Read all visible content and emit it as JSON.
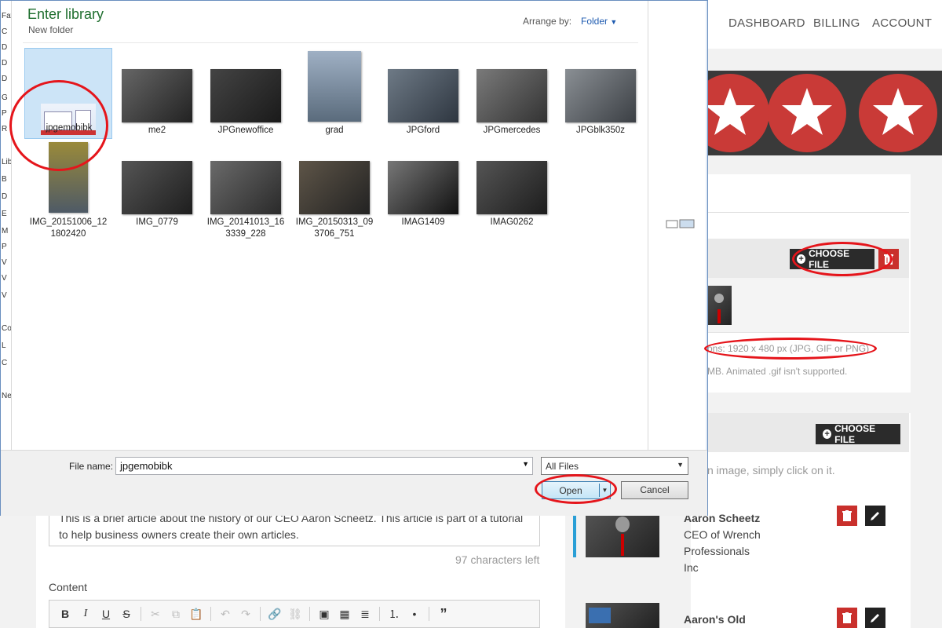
{
  "nav": {
    "dashboard": "DASHBOARD",
    "billing": "BILLING",
    "account": "ACCOUNT"
  },
  "upload": {
    "choose_file_label": "CHOOSE FILE",
    "dimensions_hint": "ons: 1920 x 480 px (JPG, GIF or PNG)",
    "size_hint": "MB. Animated .gif isn't supported.",
    "choose_file_label_2": "CHOOSE FILE",
    "click_hint": "n image, simply click on it."
  },
  "authors": [
    {
      "name": "Aaron Scheetz",
      "title_lines": [
        "CEO of Wrench",
        "Professionals",
        "Inc"
      ]
    },
    {
      "name": "Aaron's Old"
    }
  ],
  "article": {
    "summary_lines": [
      "This is a brief article about the history of our CEO Aaron Scheetz. This article is part of a tutorial",
      "to help business owners create their own articles."
    ],
    "chars_left": "97 characters left",
    "content_label": "Content"
  },
  "dialog": {
    "title": "Enter library",
    "subtitle": "New folder",
    "arrange_label": "Arrange by:",
    "arrange_value": "Folder",
    "sidebar_fragments": [
      "Fav",
      "C",
      "D",
      "D",
      "D",
      "G",
      "P",
      "R",
      "Lib",
      "B",
      "D",
      "E",
      "M",
      "P",
      "V",
      "V",
      "V",
      "Co",
      "L",
      "C",
      "Ne"
    ],
    "files_row1": [
      "jpgemobibk",
      "me2",
      "JPGnewoffice",
      "grad",
      "JPGford",
      "JPGmercedes",
      "JPGblk350z"
    ],
    "files_row2": [
      [
        "IMG_20151006_12",
        "1802420"
      ],
      [
        "IMG_0779"
      ],
      [
        "IMG_20141013_16",
        "3339_228"
      ],
      [
        "IMG_20150313_09",
        "3706_751"
      ],
      [
        "IMAG1409"
      ],
      [
        "IMAG0262"
      ]
    ],
    "file_name_label": "File name:",
    "file_name_value": "jpgemobibk",
    "file_type": "All Files",
    "open_label": "Open",
    "cancel_label": "Cancel"
  },
  "colors": {
    "accent_red": "#c9302c",
    "dialog_title": "#1e6e2e",
    "annotation": "#e5151b"
  }
}
